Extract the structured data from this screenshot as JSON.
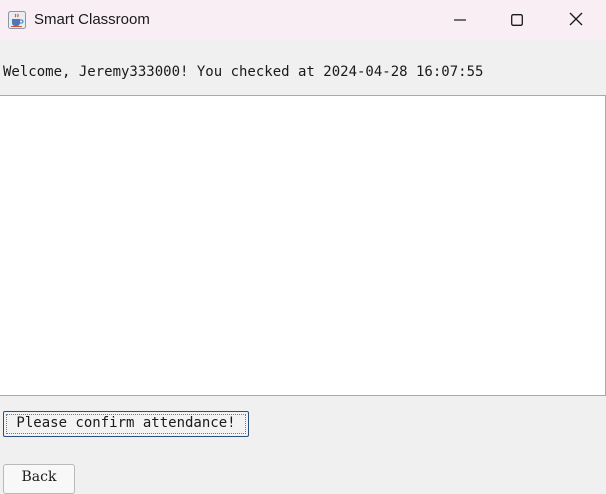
{
  "window": {
    "title": "Smart Classroom",
    "icon": "java-cup-icon",
    "controls": [
      "minimize-icon",
      "maximize-icon",
      "close-icon"
    ]
  },
  "main": {
    "welcome_text": "Welcome, Jeremy333000! You checked at 2024-04-28 16:07:55",
    "text_area_content": ""
  },
  "buttons": {
    "confirm_label": "Please confirm attendance!",
    "back_label": "Back"
  },
  "colors": {
    "titlebar_bg": "#f8eef3",
    "window_bg": "#f0f0f0",
    "text_area_bg": "#ffffff",
    "focus_border": "#2b4f7a"
  }
}
